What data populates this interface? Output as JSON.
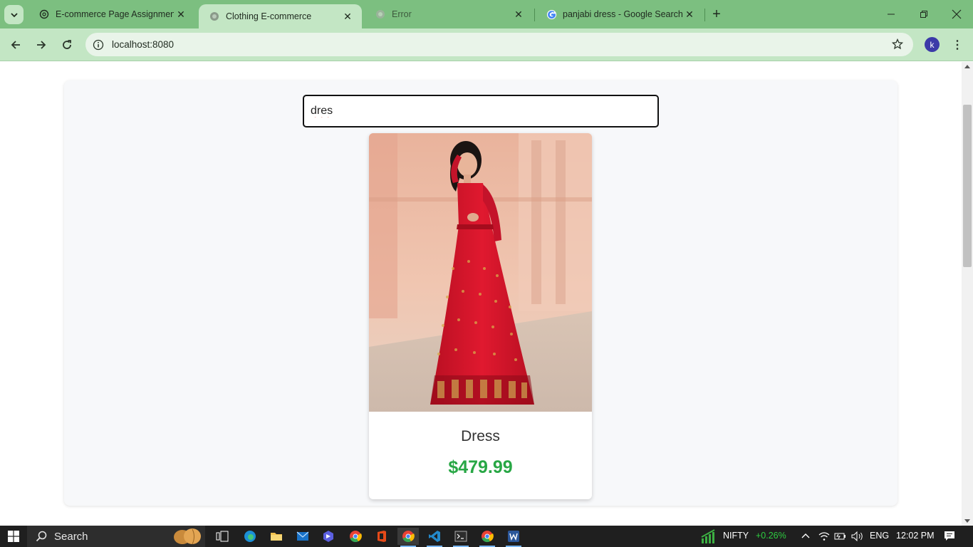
{
  "browser": {
    "tabs": [
      {
        "title": "E-commerce Page Assignment",
        "active": false
      },
      {
        "title": "Clothing E-commerce",
        "active": true
      },
      {
        "title": "Error",
        "active": false
      },
      {
        "title": "panjabi dress - Google Search",
        "active": false
      }
    ],
    "url": "localhost:8080",
    "profile_initial": "k"
  },
  "page": {
    "search": {
      "value": "dres"
    },
    "products": [
      {
        "name": "Dress",
        "price": "$479.99"
      }
    ],
    "colors": {
      "price": "#28a745",
      "input_border": "#111111"
    }
  },
  "taskbar": {
    "search_label": "Search",
    "nifty_label": "NIFTY",
    "nifty_change": "+0.26%",
    "language": "ENG",
    "time": "12:02 PM"
  }
}
